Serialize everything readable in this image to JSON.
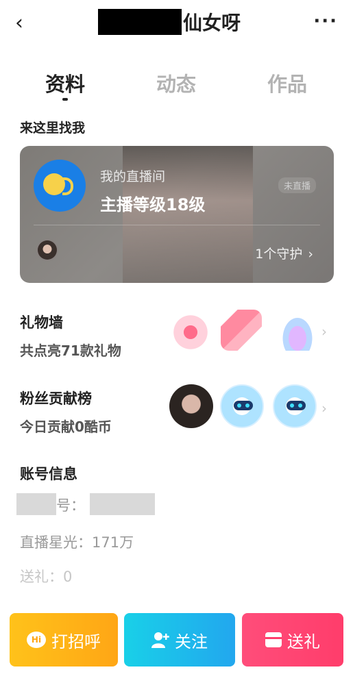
{
  "header": {
    "back_icon": "chevron-left-icon",
    "back_glyph": "‹",
    "title": "仙女呀",
    "more_glyph": "···",
    "more_icon": "more-dots-icon"
  },
  "tabs": [
    {
      "label": "资料",
      "active": true
    },
    {
      "label": "动态",
      "active": false
    },
    {
      "label": "作品",
      "active": false
    }
  ],
  "find_me": {
    "section_title": "来这里找我",
    "live": {
      "subtitle": "我的直播间",
      "level": "主播等级18级",
      "status": "未直播",
      "guard": "1个守护",
      "guard_chevron": "›"
    }
  },
  "gift_wall": {
    "title": "礼物墙",
    "summary": "共点亮71款礼物",
    "chevron": "›"
  },
  "fans": {
    "title": "粉丝贡献榜",
    "summary": "今日贡献0酷币",
    "chevron": "›"
  },
  "account": {
    "title": "账号信息",
    "id_label": "号：",
    "star_light": "直播星光：171万",
    "gifts_sent": "送礼：0"
  },
  "actions": {
    "hi": {
      "label": "打招呼",
      "icon_text": "Hi"
    },
    "follow": {
      "label": "关注",
      "icon_glyph": "👤"
    },
    "gift": {
      "label": "送礼"
    }
  },
  "colors": {
    "hi_button": "#ffb01a",
    "follow_button": "#1fbbea",
    "gift_button": "#ff4472",
    "live_logo": "#1a7fe6"
  }
}
